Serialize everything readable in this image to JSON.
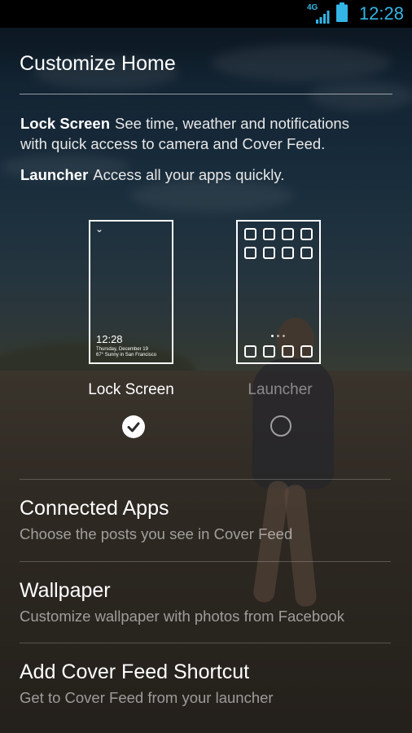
{
  "status_bar": {
    "network_label": "4G",
    "time": "12:28",
    "accent_color": "#33b5e5"
  },
  "title": "Customize Home",
  "descriptions": {
    "lock_screen_term": "Lock Screen",
    "lock_screen_text": "See time, weather and notifications with quick access to camera and Cover Feed.",
    "launcher_term": "Launcher",
    "launcher_text": "Access all your apps quickly."
  },
  "options": {
    "lock_screen": {
      "label": "Lock Screen",
      "selected": true,
      "preview_time": "12:28",
      "preview_date": "Thursday, December 19",
      "preview_weather": "67° Sunny in San Francisco"
    },
    "launcher": {
      "label": "Launcher",
      "selected": false
    }
  },
  "settings": [
    {
      "title": "Connected Apps",
      "subtitle": "Choose the posts you see in Cover Feed"
    },
    {
      "title": "Wallpaper",
      "subtitle": "Customize wallpaper with photos from Facebook"
    },
    {
      "title": "Add Cover Feed Shortcut",
      "subtitle": "Get to Cover Feed from your launcher"
    }
  ]
}
